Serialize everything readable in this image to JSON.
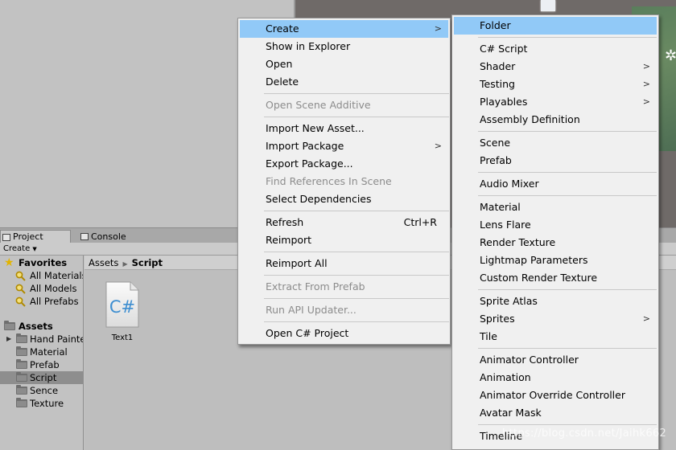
{
  "panel": {
    "tabs": [
      {
        "label": "Project"
      },
      {
        "label": "Console"
      }
    ],
    "create_label": "Create"
  },
  "tree": {
    "favorites_label": "Favorites",
    "favorites": [
      "All Materials",
      "All Models",
      "All Prefabs"
    ],
    "assets_label": "Assets",
    "folders": [
      "Hand Painte",
      "Material",
      "Prefab",
      "Script",
      "Sence",
      "Texture"
    ],
    "selected": "Script"
  },
  "breadcrumb": {
    "root": "Assets",
    "current": "Script"
  },
  "asset": {
    "name": "Text1",
    "icon_text": "C#"
  },
  "context_menu": {
    "items": [
      {
        "label": "Create"
      },
      {
        "label": "Show in Explorer"
      },
      {
        "label": "Open"
      },
      {
        "label": "Delete"
      },
      {
        "label": "Open Scene Additive"
      },
      {
        "label": "Import New Asset..."
      },
      {
        "label": "Import Package"
      },
      {
        "label": "Export Package..."
      },
      {
        "label": "Find References In Scene"
      },
      {
        "label": "Select Dependencies"
      },
      {
        "label": "Refresh",
        "shortcut": "Ctrl+R"
      },
      {
        "label": "Reimport"
      },
      {
        "label": "Reimport All"
      },
      {
        "label": "Extract From Prefab"
      },
      {
        "label": "Run API Updater..."
      },
      {
        "label": "Open C# Project"
      }
    ]
  },
  "create_submenu": {
    "items": [
      {
        "label": "Folder"
      },
      {
        "label": "C# Script"
      },
      {
        "label": "Shader"
      },
      {
        "label": "Testing"
      },
      {
        "label": "Playables"
      },
      {
        "label": "Assembly Definition"
      },
      {
        "label": "Scene"
      },
      {
        "label": "Prefab"
      },
      {
        "label": "Audio Mixer"
      },
      {
        "label": "Material"
      },
      {
        "label": "Lens Flare"
      },
      {
        "label": "Render Texture"
      },
      {
        "label": "Lightmap Parameters"
      },
      {
        "label": "Custom Render Texture"
      },
      {
        "label": "Sprite Atlas"
      },
      {
        "label": "Sprites"
      },
      {
        "label": "Tile"
      },
      {
        "label": "Animator Controller"
      },
      {
        "label": "Animation"
      },
      {
        "label": "Animator Override Controller"
      },
      {
        "label": "Avatar Mask"
      },
      {
        "label": "Timeline"
      }
    ]
  },
  "watermark": "https://blog.csdn.net/Jaihk662",
  "colors": {
    "highlight": "#91c9f7",
    "menu_bg": "#f0f0f0",
    "selected_row": "#8e8e8e"
  }
}
